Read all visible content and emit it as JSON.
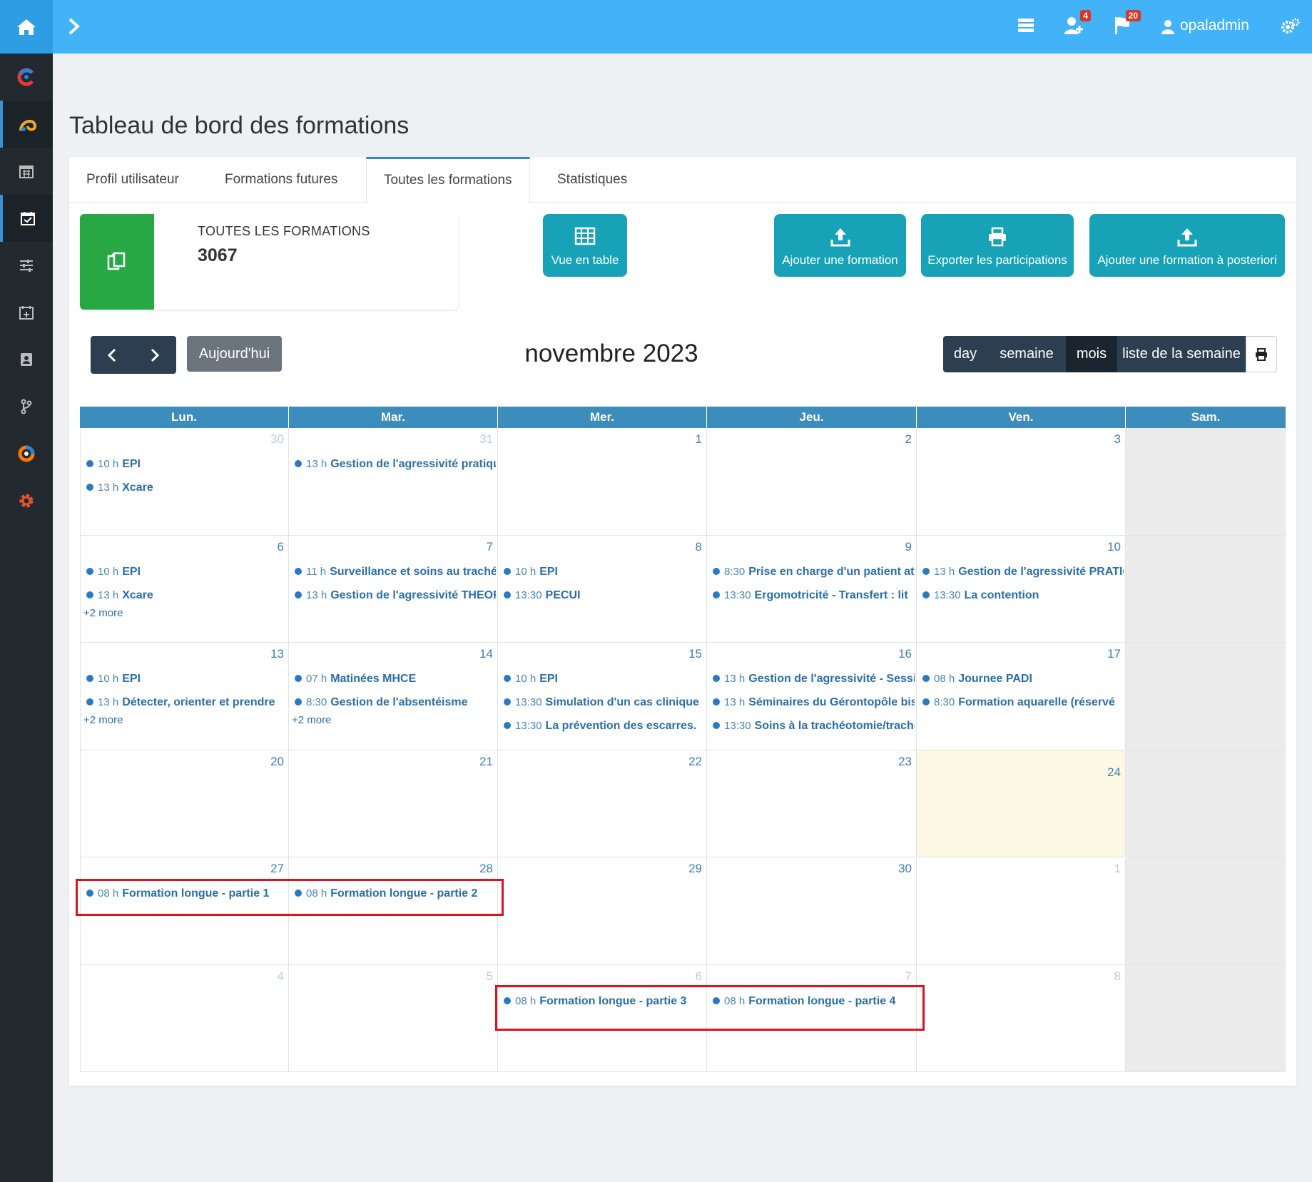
{
  "topbar": {
    "username": "opaladmin",
    "badge_users": "4",
    "badge_flags": "20"
  },
  "page": {
    "title": "Tableau de bord des formations"
  },
  "tabs": [
    "Profil utilisateur",
    "Formations futures",
    "Toutes les formations",
    "Statistiques"
  ],
  "active_tab": "Toutes les formations",
  "stat": {
    "label": "TOUTES LES FORMATIONS",
    "value": "3067"
  },
  "actions": {
    "table_view": "Vue en table",
    "add": "Ajouter une formation",
    "export": "Exporter les participations",
    "add_posteriori": "Ajouter une formation à posteriori"
  },
  "calendar": {
    "today_label": "Aujourd'hui",
    "title": "novembre 2023",
    "views": [
      "day",
      "semaine",
      "mois",
      "liste de la semaine"
    ],
    "active_view": "mois",
    "weekdays": [
      "Lun.",
      "Mar.",
      "Mer.",
      "Jeu.",
      "Ven.",
      "Sam."
    ],
    "weeks": [
      [
        {
          "day": "30",
          "other": true,
          "events": [
            {
              "time": "10 h",
              "title": "EPI"
            },
            {
              "time": "13 h",
              "title": "Xcare"
            }
          ]
        },
        {
          "day": "31",
          "other": true,
          "events": [
            {
              "time": "13 h",
              "title": "Gestion de l'agressivité pratique"
            }
          ]
        },
        {
          "day": "1",
          "events": []
        },
        {
          "day": "2",
          "events": []
        },
        {
          "day": "3",
          "events": []
        },
        {
          "day": "",
          "events": []
        }
      ],
      [
        {
          "day": "6",
          "events": [
            {
              "time": "10 h",
              "title": "EPI"
            },
            {
              "time": "13 h",
              "title": "Xcare"
            }
          ],
          "more": "+2 more"
        },
        {
          "day": "7",
          "events": [
            {
              "time": "11 h",
              "title": "Surveillance et soins au trachéo"
            },
            {
              "time": "13 h",
              "title": "Gestion de l'agressivité THEORIE"
            }
          ]
        },
        {
          "day": "8",
          "events": [
            {
              "time": "10 h",
              "title": "EPI"
            },
            {
              "time": "13:30",
              "title": "PECUI"
            }
          ]
        },
        {
          "day": "9",
          "events": [
            {
              "time": "8:30",
              "title": "Prise en charge d'un patient atteint"
            },
            {
              "time": "13:30",
              "title": "Ergomotricité - Transfert : lit"
            }
          ]
        },
        {
          "day": "10",
          "events": [
            {
              "time": "13 h",
              "title": "Gestion de l'agressivité PRATIQUE"
            },
            {
              "time": "13:30",
              "title": "La contention"
            }
          ]
        },
        {
          "day": "",
          "events": []
        }
      ],
      [
        {
          "day": "13",
          "events": [
            {
              "time": "10 h",
              "title": "EPI"
            },
            {
              "time": "13 h",
              "title": "Détecter, orienter et prendre"
            }
          ],
          "more": "+2 more"
        },
        {
          "day": "14",
          "events": [
            {
              "time": "07 h",
              "title": "Matinées MHCE"
            },
            {
              "time": "8:30",
              "title": "Gestion de l'absentéisme"
            }
          ],
          "more": "+2 more"
        },
        {
          "day": "15",
          "events": [
            {
              "time": "10 h",
              "title": "EPI"
            },
            {
              "time": "13:30",
              "title": "Simulation d'un cas clinique"
            },
            {
              "time": "13:30",
              "title": "La prévention des escarres."
            }
          ]
        },
        {
          "day": "16",
          "events": [
            {
              "time": "13 h",
              "title": "Gestion de l'agressivité - Session"
            },
            {
              "time": "13 h",
              "title": "Séminaires du Gérontopôle bis"
            },
            {
              "time": "13:30",
              "title": "Soins à la trachéotomie/trachéo"
            }
          ]
        },
        {
          "day": "17",
          "events": [
            {
              "time": "08 h",
              "title": "Journee PADI"
            },
            {
              "time": "8:30",
              "title": "Formation aquarelle (réservé"
            }
          ]
        },
        {
          "day": "",
          "events": []
        }
      ],
      [
        {
          "day": "20",
          "events": []
        },
        {
          "day": "21",
          "events": []
        },
        {
          "day": "22",
          "events": []
        },
        {
          "day": "23",
          "events": []
        },
        {
          "day": "24",
          "today": true,
          "events": []
        },
        {
          "day": "",
          "events": []
        }
      ],
      [
        {
          "day": "27",
          "events": [
            {
              "time": "08 h",
              "title": "Formation longue - partie 1"
            }
          ]
        },
        {
          "day": "28",
          "events": [
            {
              "time": "08 h",
              "title": "Formation longue - partie 2"
            }
          ]
        },
        {
          "day": "29",
          "events": []
        },
        {
          "day": "30",
          "events": []
        },
        {
          "day": "1",
          "other": true,
          "events": []
        },
        {
          "day": "",
          "events": []
        }
      ],
      [
        {
          "day": "4",
          "other": true,
          "events": []
        },
        {
          "day": "5",
          "other": true,
          "events": []
        },
        {
          "day": "6",
          "other": true,
          "events": [
            {
              "time": "08 h",
              "title": "Formation longue - partie 3"
            }
          ]
        },
        {
          "day": "7",
          "other": true,
          "events": [
            {
              "time": "08 h",
              "title": "Formation longue - partie 4"
            }
          ]
        },
        {
          "day": "8",
          "other": true,
          "events": []
        },
        {
          "day": "",
          "events": []
        }
      ]
    ]
  }
}
